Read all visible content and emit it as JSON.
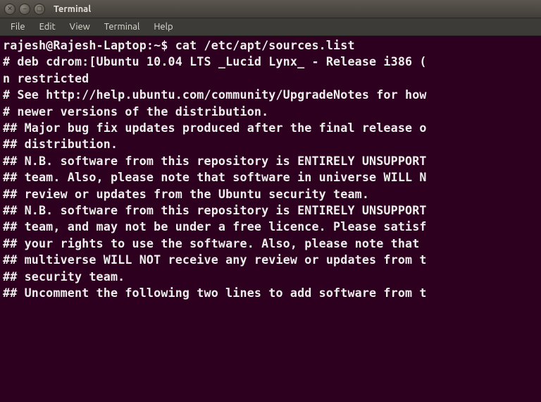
{
  "window": {
    "title": "Terminal",
    "controls": {
      "close": "✕",
      "minimize": "–",
      "maximize": "▢"
    }
  },
  "menubar": {
    "items": [
      "File",
      "Edit",
      "View",
      "Terminal",
      "Help"
    ]
  },
  "terminal": {
    "prompt": "rajesh@Rajesh-Laptop:~$ ",
    "command": "cat /etc/apt/sources.list",
    "lines": [
      "# deb cdrom:[Ubuntu 10.04 LTS _Lucid Lynx_ - Release i386 (",
      "n restricted",
      "# See http://help.ubuntu.com/community/UpgradeNotes for how",
      "# newer versions of the distribution.",
      "",
      "## Major bug fix updates produced after the final release o",
      "## distribution.",
      "",
      "## N.B. software from this repository is ENTIRELY UNSUPPORT",
      "## team. Also, please note that software in universe WILL N",
      "## review or updates from the Ubuntu security team.",
      "",
      "## N.B. software from this repository is ENTIRELY UNSUPPORT",
      "## team, and may not be under a free licence. Please satisf",
      "## your rights to use the software. Also, please note that ",
      "## multiverse WILL NOT receive any review or updates from t",
      "## security team.",
      "",
      "## Uncomment the following two lines to add software from t"
    ]
  }
}
